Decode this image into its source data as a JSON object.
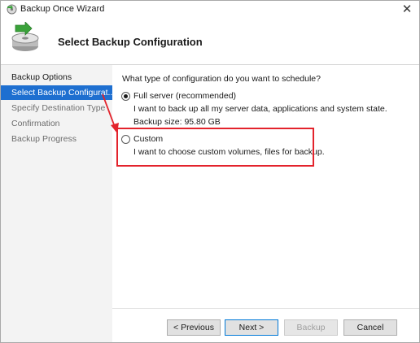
{
  "window": {
    "title": "Backup Once Wizard",
    "close_glyph": "✕"
  },
  "header": {
    "title": "Select Backup Configuration",
    "icon": "backup-wizard-icon"
  },
  "nav": {
    "items": [
      {
        "label": "Backup Options"
      },
      {
        "label": "Select Backup Configurat..."
      },
      {
        "label": "Specify Destination Type"
      },
      {
        "label": "Confirmation"
      },
      {
        "label": "Backup Progress"
      }
    ],
    "active_index": 1
  },
  "main": {
    "question": "What type of configuration do you want to schedule?",
    "options": [
      {
        "label": "Full server (recommended)",
        "description": "I want to back up all my server data, applications and system state.",
        "extra": "Backup size: 95.80 GB",
        "selected": true
      },
      {
        "label": "Custom",
        "description": "I want to choose custom volumes, files for backup.",
        "selected": false
      }
    ]
  },
  "buttons": {
    "previous": "< Previous",
    "next": "Next >",
    "backup": "Backup",
    "cancel": "Cancel"
  },
  "colors": {
    "accent": "#1e6fd0",
    "annotation": "#e3232c"
  }
}
